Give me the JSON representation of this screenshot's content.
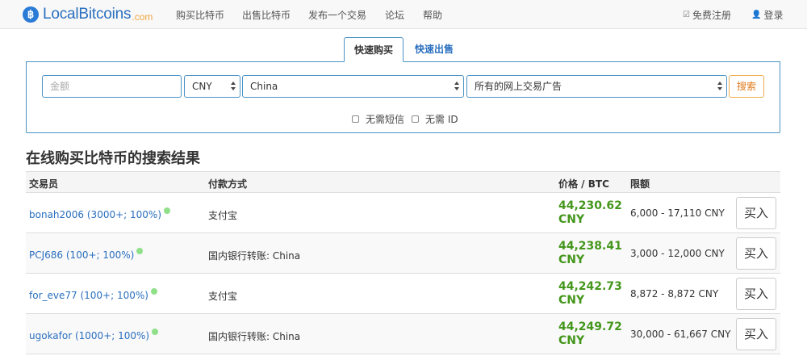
{
  "brand": {
    "icon": "bitcoin-badge-icon",
    "badge_glyph": "฿",
    "name": "LocalBitcoins",
    "suffix": ".com",
    "color": "#2a6fbf",
    "suffix_color": "#f0a640"
  },
  "nav": {
    "items": [
      {
        "label": "购买比特币"
      },
      {
        "label": "出售比特币"
      },
      {
        "label": "发布一个交易"
      },
      {
        "label": "论坛"
      },
      {
        "label": "帮助"
      }
    ],
    "register": {
      "label": "免费注册",
      "icon": "edit-square-icon",
      "glyph": "☑"
    },
    "login": {
      "label": "登录",
      "icon": "user-icon",
      "glyph": "👤"
    }
  },
  "search": {
    "tabs": [
      {
        "label": "快速购买",
        "active": true
      },
      {
        "label": "快速出售",
        "active": false
      }
    ],
    "amount_placeholder": "金额",
    "currency": "CNY",
    "country": "China",
    "payment_method": "所有的网上交易广告",
    "search_label": "搜索",
    "checkbox_no_sms": "无需短信",
    "checkbox_no_id": "无需 ID"
  },
  "results": {
    "title": "在线购买比特币的搜索结果",
    "headers": {
      "trader": "交易员",
      "payment": "付款方式",
      "price": "价格 / BTC",
      "limit": "限额"
    },
    "rows": [
      {
        "trader": "bonah2006 (3000+; 100%)",
        "payment": "支付宝",
        "price": "44,230.62",
        "currency": "CNY",
        "limit": "6,000 - 17,110 CNY",
        "buy": "买入"
      },
      {
        "trader": "PCJ686 (100+; 100%)",
        "payment": "国内银行转账: China",
        "price": "44,238.41",
        "currency": "CNY",
        "limit": "3,000 - 12,000 CNY",
        "buy": "买入"
      },
      {
        "trader": "for_eve77 (100+; 100%)",
        "payment": "支付宝",
        "price": "44,242.73",
        "currency": "CNY",
        "limit": "8,872 - 8,872 CNY",
        "buy": "买入"
      },
      {
        "trader": "ugokafor (1000+; 100%)",
        "payment": "国内银行转账: China",
        "price": "44,249.72",
        "currency": "CNY",
        "limit": "30,000 - 61,667 CNY",
        "buy": "买入"
      }
    ]
  },
  "colors": {
    "price_green": "#44961c",
    "online_dot": "#90e08a",
    "panel_border": "#4b93c5",
    "search_orange": "#e07a1a"
  }
}
